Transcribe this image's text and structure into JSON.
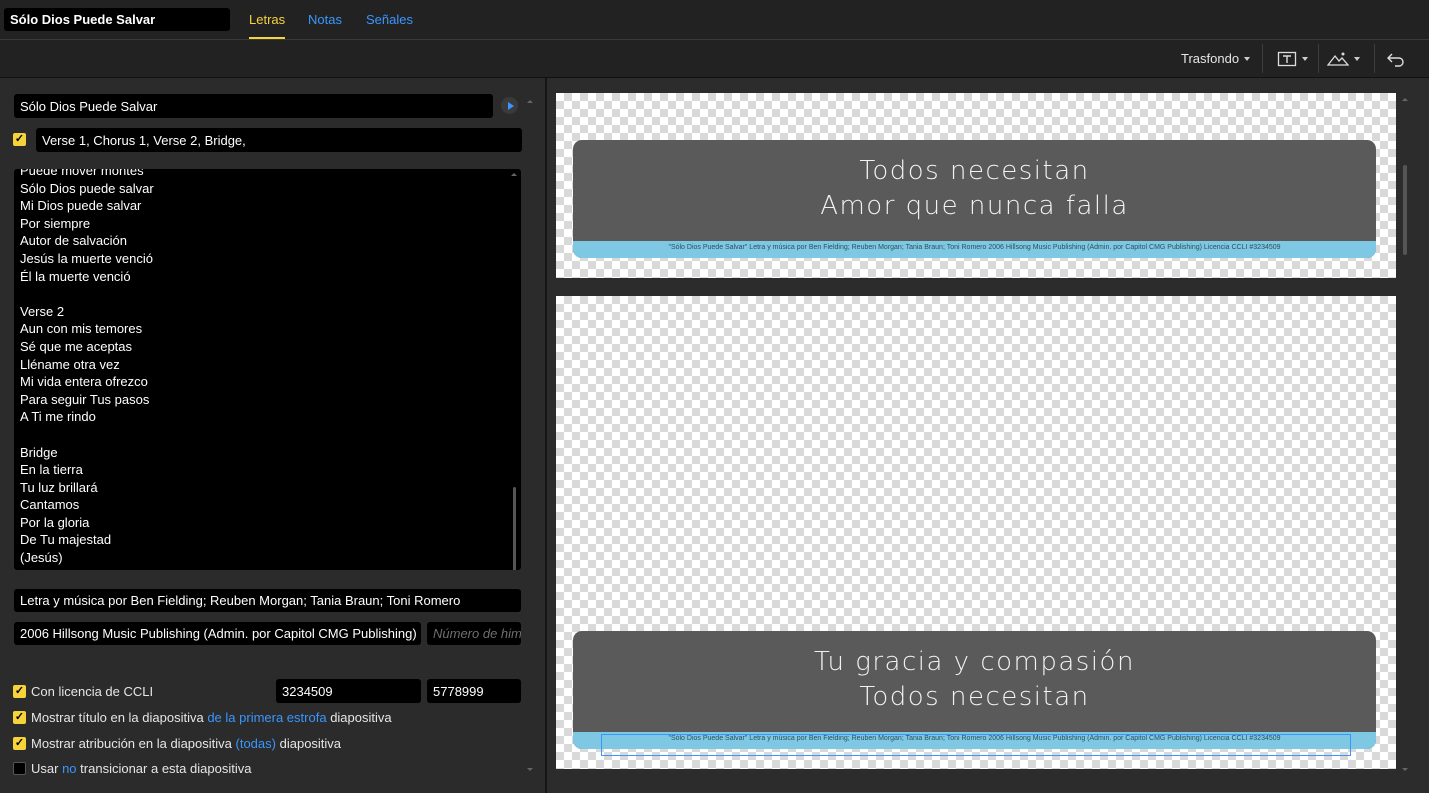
{
  "header": {
    "title_value": "Sólo Dios Puede Salvar",
    "tabs": [
      {
        "label": "Letras",
        "active": true
      },
      {
        "label": "Notas",
        "active": false
      },
      {
        "label": "Señales",
        "active": false
      }
    ]
  },
  "toolbar": {
    "background_label": "Trasfondo",
    "icons": [
      "text-box-icon",
      "image-icon",
      "undo-icon"
    ]
  },
  "editor": {
    "song_title": "Sólo Dios Puede Salvar",
    "arrangement_checked": true,
    "arrangement": "Verse 1, Chorus 1, Verse 2, Bridge,",
    "lyrics": "Puede mover montes\nSólo Dios puede salvar\nMi Dios puede salvar\nPor siempre\nAutor de salvación\nJesús la muerte venció\nÉl la muerte venció\n\nVerse 2\nAun con mis temores\nSé que me aceptas\nLléname otra vez\nMi vida entera ofrezco\nPara seguir Tus pasos\nA Ti me rindo\n\nBridge\nEn la tierra\nTu luz brillará\nCantamos\nPor la gloria\nDe Tu majestad\n(Jesús)",
    "authors": "Letra y música por Ben Fielding; Reuben Morgan; Tania Braun; Toni Romero",
    "copyright": "2006 Hillsong Music Publishing (Admin. por Capitol CMG Publishing)",
    "hymn_placeholder": "Número de himno",
    "ccli_label": "Con licencia de CCLI",
    "ccli_checked": true,
    "ccli_license": "3234509",
    "ccli_song": "5778999",
    "show_title_prefix": "Mostrar título en la diapositiva",
    "show_title_link": "de la primera estrofa",
    "show_title_suffix": "diapositiva",
    "show_title_checked": true,
    "show_attr_prefix": "Mostrar atribución en la diapositiva",
    "show_attr_link": "(todas)",
    "show_attr_suffix": "diapositiva",
    "show_attr_checked": true,
    "transition_prefix": "Usar",
    "transition_link": "no",
    "transition_suffix": "transicionar a esta diapositiva",
    "transition_checked": false
  },
  "slides": [
    {
      "line1": "Todos necesitan",
      "line2": "Amor que nunca falla",
      "attribution": "\"Sólo Dios Puede Salvar\" Letra y música por Ben Fielding; Reuben Morgan; Tania Braun; Toni Romero 2006 Hillsong Music Publishing (Admin. por Capitol CMG Publishing) Licencia CCLI #3234509"
    },
    {
      "line1": "Tu gracia y compasión",
      "line2": "Todos necesitan",
      "attribution": "\"Sólo Dios Puede Salvar\" Letra y música por Ben Fielding; Reuben Morgan; Tania Braun; Toni Romero 2006 Hillsong Music Publishing (Admin. por Capitol CMG Publishing) Licencia CCLI #3234509"
    }
  ],
  "colors": {
    "accent_yellow": "#f6d33a",
    "link_blue": "#3a96ff",
    "band": "#7ec8e3"
  }
}
